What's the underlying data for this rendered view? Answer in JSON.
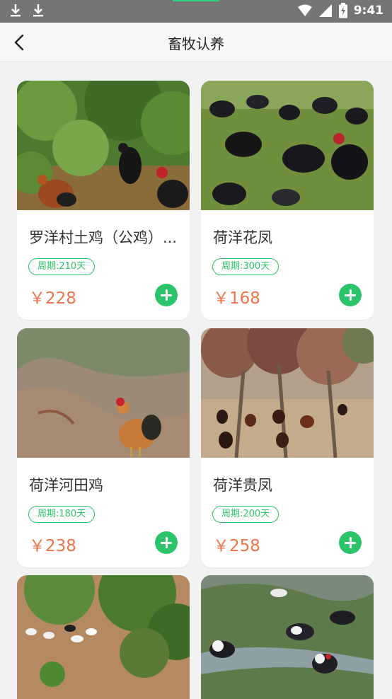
{
  "status_bar": {
    "time": "9:41",
    "icons": [
      "download-icon",
      "download-icon",
      "wifi-icon",
      "signal-icon",
      "battery-charging-icon"
    ]
  },
  "header": {
    "title": "畜牧认养",
    "back_icon": "chevron-left-icon"
  },
  "colors": {
    "accent_green": "#2cc46a",
    "price_orange": "#f0744a",
    "status_bar": "#757575"
  },
  "products": [
    {
      "name": "罗洋村土鸡（公鸡）...",
      "period": "周期:210天",
      "price": "￥228",
      "image": "rooster-in-bushes"
    },
    {
      "name": "荷洋花凤",
      "period": "周期:300天",
      "price": "￥168",
      "image": "black-chickens-on-grass"
    },
    {
      "name": "荷洋河田鸡",
      "period": "周期:180天",
      "price": "￥238",
      "image": "rooster-on-dirt"
    },
    {
      "name": "荷洋贵凤",
      "period": "周期:200天",
      "price": "￥258",
      "image": "chickens-under-trees"
    },
    {
      "name": "",
      "period": "",
      "price": "",
      "image": "ducks-on-hillside"
    },
    {
      "name": "",
      "period": "",
      "price": "",
      "image": "muscovy-ducks-in-field"
    }
  ]
}
